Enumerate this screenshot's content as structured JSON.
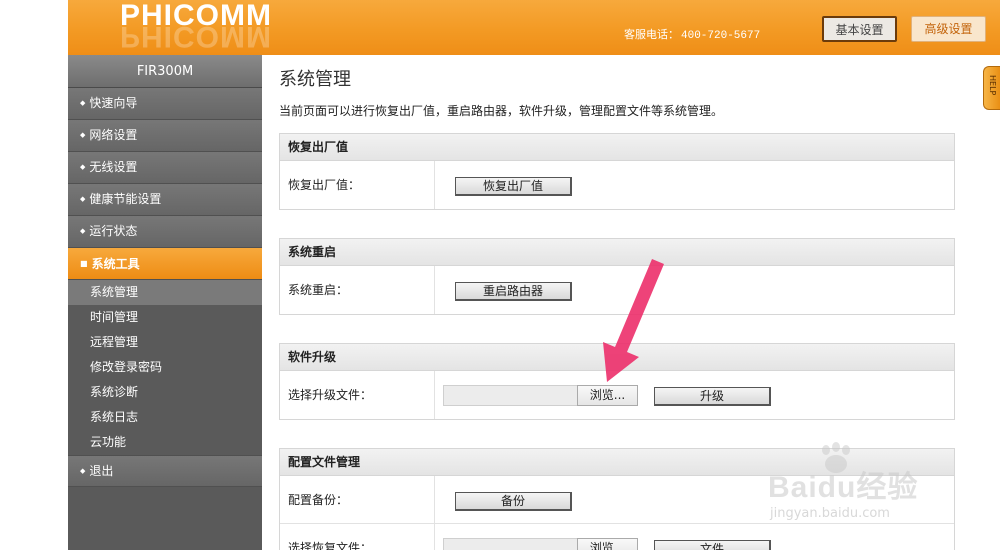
{
  "header": {
    "logo": "PHICOMM",
    "hotline_label": "客服电话：",
    "hotline_number": "400-720-5677",
    "basic_button": "基本设置",
    "advanced_button": "高级设置"
  },
  "help_tab": "HELP",
  "sidebar": {
    "model": "FIR300M",
    "items": [
      {
        "label": "快速向导",
        "active": false
      },
      {
        "label": "网络设置",
        "active": false
      },
      {
        "label": "无线设置",
        "active": false
      },
      {
        "label": "健康节能设置",
        "active": false
      },
      {
        "label": "运行状态",
        "active": false
      },
      {
        "label": "系统工具",
        "active": true
      }
    ],
    "subitems": [
      {
        "label": "系统管理",
        "active": true
      },
      {
        "label": "时间管理",
        "active": false
      },
      {
        "label": "远程管理",
        "active": false
      },
      {
        "label": "修改登录密码",
        "active": false
      },
      {
        "label": "系统诊断",
        "active": false
      },
      {
        "label": "系统日志",
        "active": false
      },
      {
        "label": "云功能",
        "active": false
      }
    ],
    "exit": "退出",
    "bullet": "◆",
    "active_bullet": "■"
  },
  "main": {
    "title": "系统管理",
    "description": "当前页面可以进行恢复出厂值，重启路由器，软件升级，管理配置文件等系统管理。",
    "factory_reset": {
      "header": "恢复出厂值",
      "label": "恢复出厂值：",
      "button": "恢复出厂值"
    },
    "reboot": {
      "header": "系统重启",
      "label": "系统重启：",
      "button": "重启路由器"
    },
    "upgrade": {
      "header": "软件升级",
      "label": "选择升级文件：",
      "browse": "浏览...",
      "button": "升级"
    },
    "config": {
      "header": "配置文件管理",
      "backup_label": "配置备份：",
      "backup_button": "备份",
      "restore_label": "选择恢复文件：",
      "restore_browse": "浏览...",
      "restore_button": "文件"
    }
  },
  "watermark": {
    "text": "Baidu经验",
    "url": "jingyan.baidu.com"
  },
  "colors": {
    "accent": "#f39a24",
    "sidebar": "#5a5a5a",
    "arrow": "#ec2f6a"
  }
}
